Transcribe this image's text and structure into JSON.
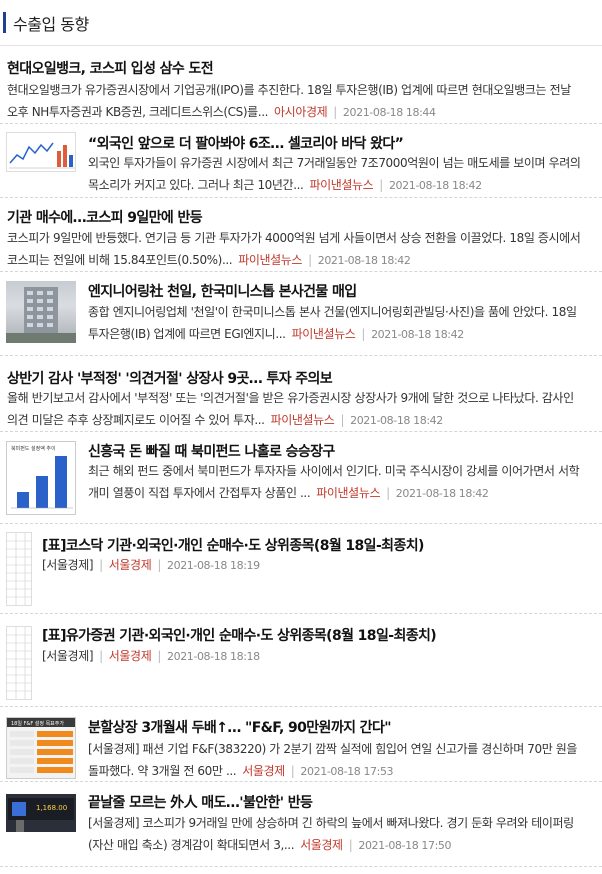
{
  "section": {
    "title": "수출입 동향"
  },
  "articles": [
    {
      "headline": "현대오일뱅크, 코스피 입성 삼수 도전",
      "summary": "현대오일뱅크가 유가증권시장에서 기업공개(IPO)를 추진한다. 18일 투자은행(IB) 업계에 따르면 현대오일뱅크는 전날 오후 NH투자증권과 KB증권, 크레디트스위스(CS)를...",
      "source": "아시아경제",
      "date": "2021-08-18 18:44"
    },
    {
      "headline": "“외국인 앞으로 더 팔아봐야 6조… 셀코리아 바닥 왔다”",
      "summary": "외국인 투자가들이 유가증권 시장에서 최근 7거래일동안 7조7000억원이 넘는 매도세를 보이며 우려의 목소리가 커지고 있다. 그러나 최근 10년간...",
      "source": "파이낸셜뉴스",
      "date": "2021-08-18 18:42",
      "thumb": "chart-thumbnail"
    },
    {
      "headline": "기관 매수에…코스피 9일만에 반등",
      "summary": "코스피가 9일만에 반등했다. 연기금 등 기관 투자가가 4000억원 넘게 사들이면서 상승 전환을 이끌었다. 18일 증시에서 코스피는 전일에 비해 15.84포인트(0.50%)...",
      "source": "파이낸셜뉴스",
      "date": "2021-08-18 18:42"
    },
    {
      "headline": "엔지니어링社 천일, 한국미니스톱 본사건물 매입",
      "summary": "종합 엔지니어링업체 '천일'이 한국미니스톱 본사 건물(엔지니어링회관빌딩·사진)을 품에 안았다. 18일 투자은행(IB) 업계에 따르면 EGI엔지니...",
      "source": "파이낸셜뉴스",
      "date": "2021-08-18 18:42",
      "thumb": "building-photo"
    },
    {
      "headline": "상반기 감사 '부적정' '의견거절' 상장사 9곳… 투자 주의보",
      "summary": "올해 반기보고서 감사에서 '부적정' 또는 '의견거절'을 받은 유가증권시장 상장사가 9개에 달한 것으로 나타났다. 감사인 의견 미달은 추후 상장폐지로도 이어질 수 있어 투자...",
      "source": "파이낸셜뉴스",
      "date": "2021-08-18 18:42"
    },
    {
      "headline": "신흥국 돈 빠질 때 북미펀드 나홀로 승승장구",
      "summary": "최근 해외 펀드 중에서 북미펀드가 투자자들 사이에서 인기다. 미국 주식시장이 강세를 이어가면서 서학 개미 열풍이 직접 투자에서 간접투자 상품인 ...",
      "source": "파이낸셜뉴스",
      "date": "2021-08-18 18:42",
      "thumb": "bar-chart-thumbnail"
    },
    {
      "headline": "[표]코스닥 기관·외국인·개인 순매수·도 상위종목(8월 18일-최종치)",
      "summary": "[서울경제]",
      "source": "서울경제",
      "date": "2021-08-18 18:19",
      "thumb": "table-thumbnail"
    },
    {
      "headline": "[표]유가증권 기관·외국인·개인 순매수·도 상위종목(8월 18일-최종치)",
      "summary": "[서울경제]",
      "source": "서울경제",
      "date": "2021-08-18 18:18",
      "thumb": "table-thumbnail"
    },
    {
      "headline": "분할상장 3개월새 두배↑… \"F&F, 90만원까지 간다\"",
      "summary": "[서울경제] 패션 기업 F&F(383220) 가 2분기 깜짝 실적에 힘입어 연일 신고가를 경신하며 70만 원을 돌파했다. 약 3개월 전 60만 ...",
      "source": "서울경제",
      "date": "2021-08-18 17:53",
      "thumb": "ff-table-thumbnail"
    },
    {
      "headline": "끝날줄 모르는 外人 매도…'불안한' 반등",
      "summary": "[서울경제] 코스피가 9거래일 만에 상승하며 긴 하락의 늪에서 빠져나왔다. 경기 둔화 우려와 테이퍼링(자산 매입 축소) 경계감이 확대되면서 3,...",
      "source": "서울경제",
      "date": "2021-08-18 17:50",
      "thumb": "market-board-photo"
    }
  ],
  "thumb_texts": {
    "bars_title": "북미펀드 설정액 추이",
    "ff_title": "18일 F&F 설정 목표주가",
    "market_num": "1,168.00"
  },
  "colors": {
    "accent": "#1f3f8f",
    "source": "#c0392b",
    "date": "#888888"
  }
}
